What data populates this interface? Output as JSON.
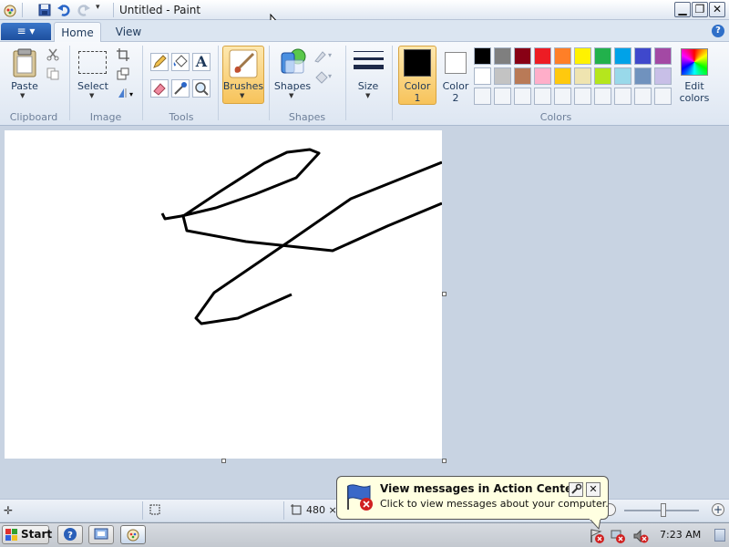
{
  "window": {
    "title": "Untitled - Paint"
  },
  "tabs": {
    "file_label": "≡ ▾",
    "home": "Home",
    "view": "View"
  },
  "ribbon": {
    "clipboard": {
      "paste": "Paste",
      "group": "Clipboard"
    },
    "image": {
      "select": "Select",
      "group": "Image"
    },
    "tools": {
      "group": "Tools",
      "text_tool": "A"
    },
    "brushes": {
      "label": "Brushes"
    },
    "shapes": {
      "label": "Shapes",
      "group": "Shapes"
    },
    "size": {
      "label": "Size"
    },
    "colors": {
      "color1": "Color",
      "color1_num": "1",
      "color2": "Color",
      "color2_num": "2",
      "edit1": "Edit",
      "edit2": "colors",
      "group": "Colors",
      "palette_row1": [
        "#000000",
        "#7f7f7f",
        "#880015",
        "#ed1c24",
        "#ff7f27",
        "#fff200",
        "#22b14c",
        "#00a2e8",
        "#3f48cc",
        "#a349a4"
      ],
      "palette_row2": [
        "#ffffff",
        "#c3c3c3",
        "#b97a57",
        "#ffaec9",
        "#ffc90e",
        "#efe4b0",
        "#b5e61d",
        "#99d9ea",
        "#7092be",
        "#c8bfe7"
      ]
    }
  },
  "status": {
    "dims": "480 ×"
  },
  "balloon": {
    "title": "View messages in Action Center",
    "text": "Click to view messages about your computer."
  },
  "taskbar": {
    "start": "Start",
    "time": "7:23 AM"
  }
}
